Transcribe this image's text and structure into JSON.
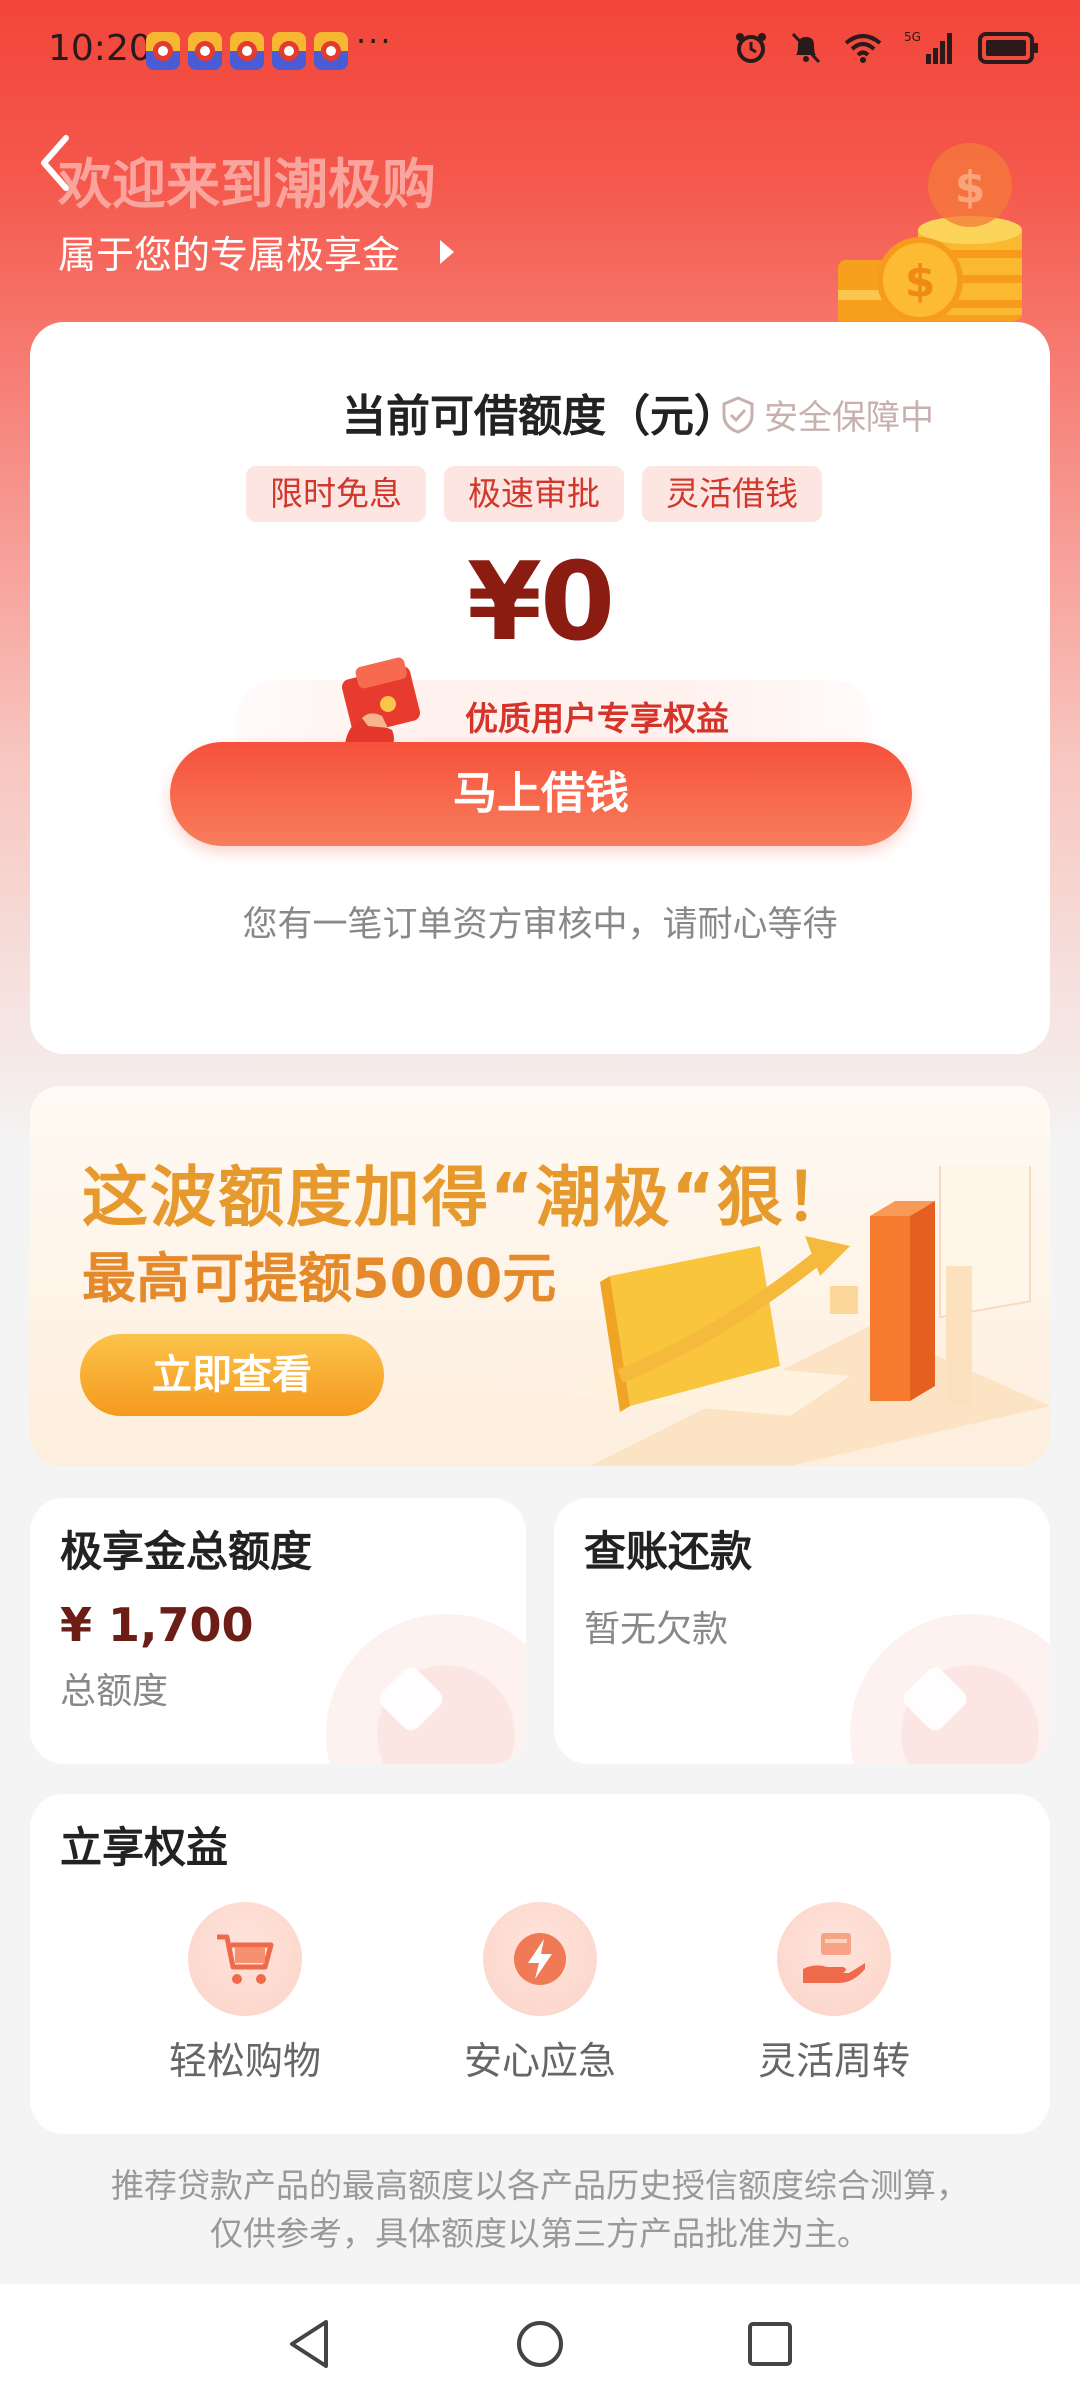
{
  "status_bar": {
    "time": "10:20",
    "more": "···",
    "notification_count": 5,
    "network": "5G"
  },
  "header": {
    "title": "欢迎来到潮极购",
    "subtitle": "属于您的专属极享金"
  },
  "credit_card": {
    "label": "当前可借额度（元）",
    "safety": "安全保障中",
    "tags": [
      "限时免息",
      "极速审批",
      "灵活借钱"
    ],
    "amount": "¥0",
    "benefit_text": "优质用户专享权益",
    "borrow_button": "马上借钱",
    "note": "您有一笔订单资方审核中，请耐心等待"
  },
  "banner": {
    "title": "这波额度加得“潮极“狠！",
    "subtitle": "最高可提额5000元",
    "button": "立即查看"
  },
  "total_card": {
    "title": "极享金总额度",
    "amount": "¥ 1,700",
    "sub": "总额度"
  },
  "repay_card": {
    "title": "查账还款",
    "sub": "暂无欠款"
  },
  "benefits": {
    "title": "立享权益",
    "items": [
      {
        "label": "轻松购物",
        "icon": "cart-icon"
      },
      {
        "label": "安心应急",
        "icon": "lightning-icon"
      },
      {
        "label": "灵活周转",
        "icon": "hand-coin-icon"
      }
    ]
  },
  "disclaimer": {
    "line1": "推荐贷款产品的最高额度以各产品历史授信额度综合测算，",
    "line2": "仅供参考，具体额度以第三方产品批准为主。"
  },
  "colors": {
    "brand_red": "#f2453a",
    "amount_dark_red": "#8b1c12",
    "banner_orange": "#e69a2d"
  }
}
